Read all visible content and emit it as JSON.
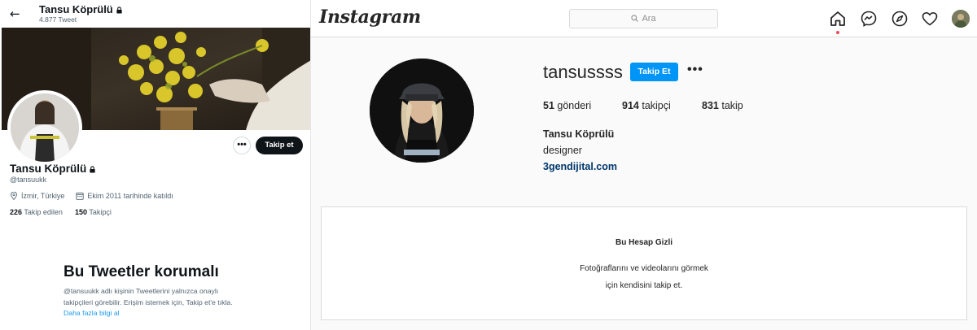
{
  "twitter": {
    "header": {
      "back_icon": "arrow-left-icon",
      "name": "Tansu Köprülü",
      "tweet_count": "4.877 Tweet"
    },
    "profile": {
      "name": "Tansu Köprülü",
      "handle": "@tansuukk",
      "location": "İzmir, Türkiye",
      "joined": "Ekim 2011 tarihinde katıldı",
      "following_count": "226",
      "following_label": "Takip edilen",
      "followers_count": "150",
      "followers_label": "Takipçi",
      "more_label": "•••",
      "follow_button": "Takip et"
    },
    "protected": {
      "title": "Bu Tweetler korumalı",
      "description": "@tansuukk adlı kişinin Tweetlerini yalnızca onaylı takipçileri görebilir. Erişim istemek için, Takip et'e tıkla.",
      "learn_more": "Daha fazla bilgi al"
    },
    "colors": {
      "accent": "#1d9bf0",
      "text": "#0f1419",
      "muted": "#536471"
    }
  },
  "instagram": {
    "logo": "Instagram",
    "search": {
      "placeholder": "Ara"
    },
    "nav_icons": [
      "home-icon",
      "messenger-icon",
      "explore-compass-icon",
      "heart-icon",
      "profile-avatar"
    ],
    "profile": {
      "username": "tansussss",
      "follow_button": "Takip Et",
      "more_label": "•••",
      "posts_count": "51",
      "posts_label": "gönderi",
      "followers_count": "914",
      "followers_label": "takipçi",
      "following_count": "831",
      "following_label": "takip",
      "full_name": "Tansu Köprülü",
      "bio": "designer",
      "link": "3gendijital.com"
    },
    "private_notice": {
      "title": "Bu Hesap Gizli",
      "line1": "Fotoğraflarını ve videolarını görmek",
      "line2": "için kendisini takip et."
    },
    "colors": {
      "accent": "#0095f6",
      "link": "#00376b",
      "notification_dot": "#ed4956"
    }
  }
}
